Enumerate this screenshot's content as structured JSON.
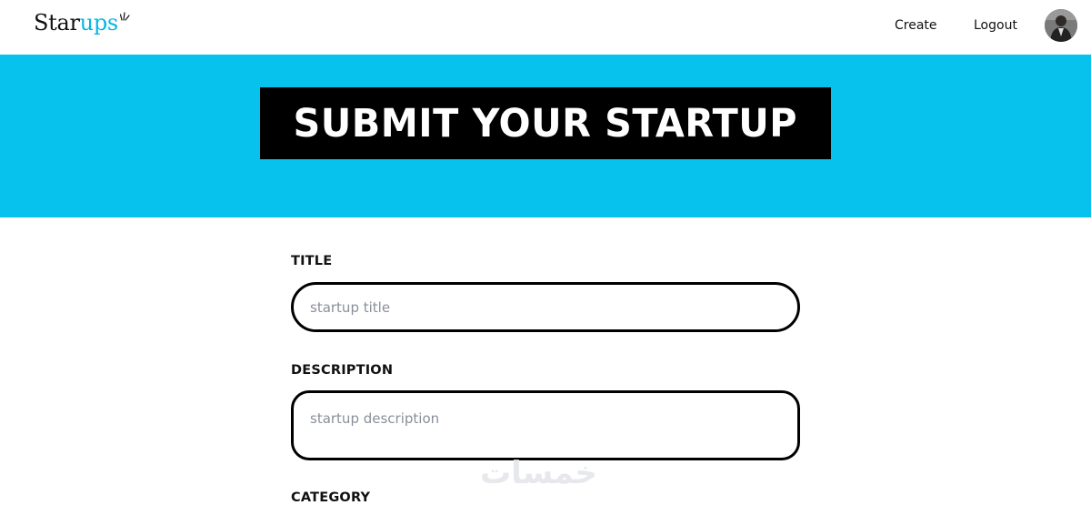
{
  "navbar": {
    "logo_prefix": "Star",
    "logo_suffix": "ups",
    "create_label": "Create",
    "logout_label": "Logout"
  },
  "hero": {
    "title": "SUBMIT YOUR STARTUP"
  },
  "form": {
    "title_label": "TITLE",
    "title_placeholder": "startup title",
    "description_label": "DESCRIPTION",
    "description_placeholder": "startup description",
    "category_label": "CATEGORY"
  },
  "watermark": {
    "text": "خمسات"
  },
  "colors": {
    "accent": "#06c2ec",
    "logo_accent": "#06b6e4",
    "title_box": "#000000",
    "text": "#111111"
  },
  "icons": {
    "avatar": "user-photo",
    "logo_mark": "sparkle-rays-icon"
  }
}
